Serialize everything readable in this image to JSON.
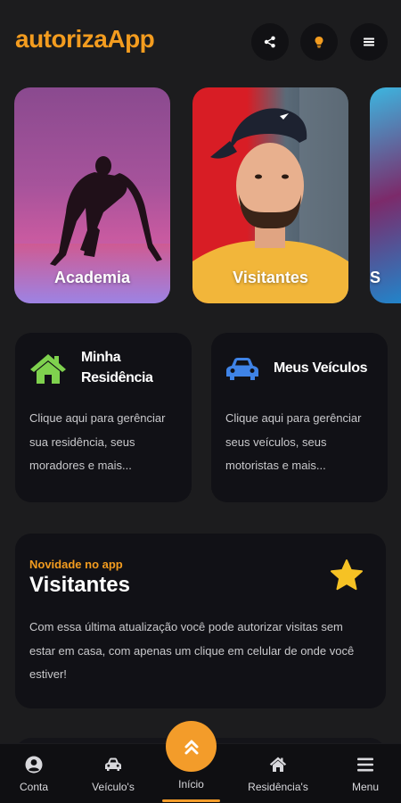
{
  "app": {
    "title": "autorizaApp"
  },
  "header": {
    "icons": [
      "share-icon",
      "lightbulb-icon",
      "menu-icon"
    ]
  },
  "carousel": [
    {
      "label": "Academia"
    },
    {
      "label": "Visitantes"
    },
    {
      "label": "S"
    }
  ],
  "shortcuts": [
    {
      "title_line1": "Minha",
      "title_line2": "Residência",
      "description": "Clique aqui para gerênciar sua residência, seus moradores e mais...",
      "icon": "house-icon"
    },
    {
      "title": "Meus Veículos",
      "description": "Clique aqui para gerênciar seus veículos, seus motoristas e mais...",
      "icon": "car-icon"
    }
  ],
  "news": {
    "kicker": "Novidade no app",
    "title": "Visitantes",
    "text": "Com essa última atualização você pode autorizar visitas sem estar em casa, com apenas um clique em celular de onde você estiver!",
    "icon": "star-icon"
  },
  "nav": {
    "items": [
      {
        "label": "Conta",
        "icon": "user-icon"
      },
      {
        "label": "Veículo's",
        "icon": "car-icon"
      },
      {
        "label": "Início",
        "icon": "chevrons-up-icon"
      },
      {
        "label": "Residência's",
        "icon": "home-icon"
      },
      {
        "label": "Menu",
        "icon": "menu-icon"
      }
    ]
  },
  "colors": {
    "accent": "#f39c1f",
    "background": "#1c1c1e",
    "card": "#111116",
    "house_icon": "#7fd14e",
    "car_icon": "#3f83e6"
  }
}
